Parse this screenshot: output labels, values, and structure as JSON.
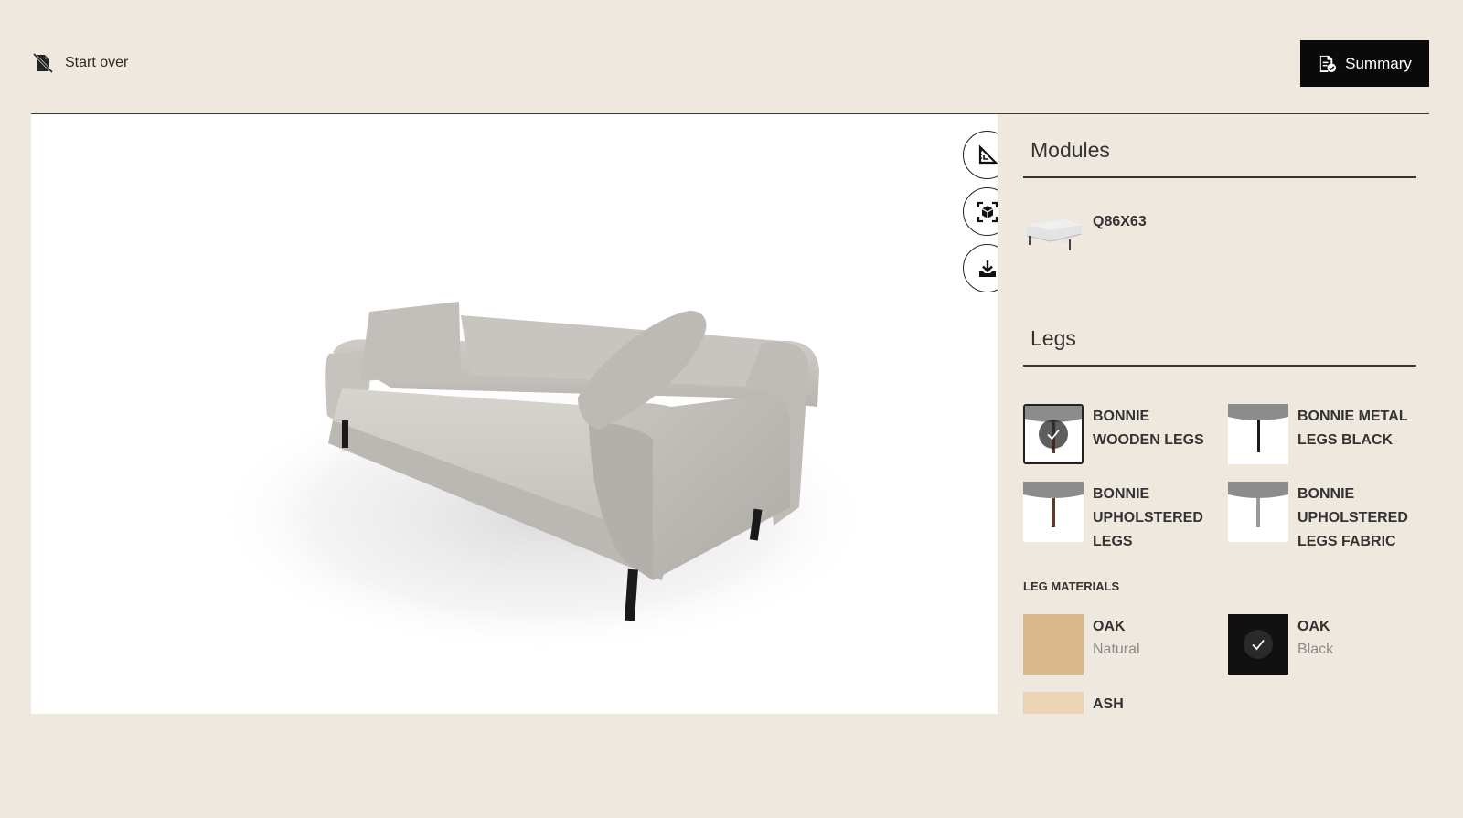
{
  "header": {
    "start_over_label": "Start over",
    "summary_label": "Summary"
  },
  "viewer": {
    "tools": [
      {
        "name": "measure",
        "icon": "ruler-triangle-icon"
      },
      {
        "name": "ar-view",
        "icon": "ar-cube-icon"
      },
      {
        "name": "download",
        "icon": "download-icon"
      }
    ],
    "fabric_color": "#c9c6c1",
    "leg_color": "#1a1a1a"
  },
  "panel": {
    "modules": {
      "title": "Modules",
      "items": [
        {
          "label": "Q86X63"
        }
      ]
    },
    "legs": {
      "title": "Legs",
      "options": [
        {
          "line1": "BONNIE",
          "line2": "WOODEN LEGS",
          "line3": "",
          "selected": true
        },
        {
          "line1": "BONNIE METAL",
          "line2": "LEGS BLACK",
          "line3": "",
          "selected": false
        },
        {
          "line1": "BONNIE",
          "line2": "UPHOLSTERED",
          "line3": "LEGS",
          "selected": false
        },
        {
          "line1": "BONNIE",
          "line2": "UPHOLSTERED",
          "line3": "LEGS FABRIC",
          "selected": false
        }
      ],
      "materials_heading": "LEG MATERIALS",
      "materials": [
        {
          "name": "OAK",
          "variant": "Natural",
          "color": "#d9b88b",
          "selected": false
        },
        {
          "name": "OAK",
          "variant": "Black",
          "color": "#111111",
          "selected": true
        },
        {
          "name": "ASH",
          "variant": "",
          "color": "#ecd3b4",
          "selected": false
        }
      ]
    }
  }
}
